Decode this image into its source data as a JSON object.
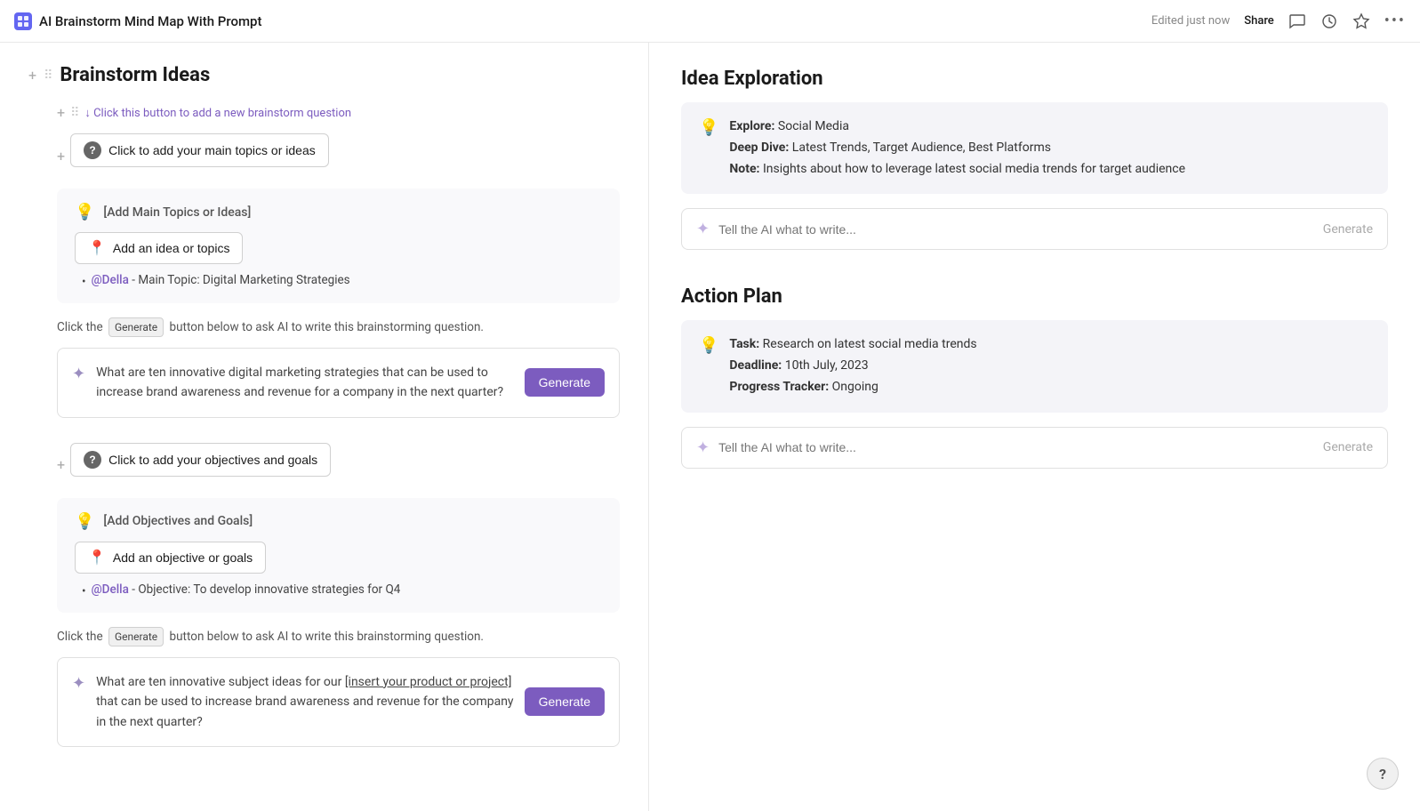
{
  "topbar": {
    "app_icon": "AI",
    "title": "AI Brainstorm Mind Map With Prompt",
    "edited_text": "Edited just now",
    "share_label": "Share",
    "more_icon": "•••"
  },
  "left": {
    "section_title": "Brainstorm Ideas",
    "sub_link_text": "↓ Click this button to add a new brainstorm question",
    "add_topic_btn_label": "Click to add your main topics or ideas",
    "ideas_card": {
      "title": "[Add Main Topics or Ideas]",
      "add_idea_label": "Add an idea or topics",
      "bullet": "@Della - Main Topic: Digital Marketing Strategies"
    },
    "generate_hint": "Click the Generate button below to ask AI to write this brainstorming question.",
    "generate_box": {
      "text": "What are ten innovative digital marketing strategies that can be used to increase brand awareness and revenue for a company in the next quarter?",
      "btn_label": "Generate"
    },
    "objectives_section": {
      "add_goals_btn_label": "Click to add your objectives and goals",
      "card_title": "[Add Objectives and Goals]",
      "add_goal_label": "Add an objective or goals",
      "bullet": "@Della - Objective: To develop innovative strategies for Q4"
    },
    "generate_hint2": "Click the Generate button below to ask AI to write this brainstorming question.",
    "generate_box2": {
      "text_prefix": "What are ten innovative subject ideas for our ",
      "text_link": "[insert your product or project]",
      "text_suffix": " that can be used to increase brand awareness and revenue for the company in the next quarter?",
      "btn_label": "Generate"
    }
  },
  "right": {
    "idea_exploration": {
      "title": "Idea Exploration",
      "card": {
        "explore_label": "Explore:",
        "explore_value": "Social Media",
        "deep_dive_label": "Deep Dive:",
        "deep_dive_value": "Latest Trends, Target Audience, Best Platforms",
        "note_label": "Note:",
        "note_value": "Insights about how to leverage latest social media trends for target audience"
      },
      "input_placeholder": "Tell the AI what to write...",
      "generate_label": "Generate"
    },
    "action_plan": {
      "title": "Action Plan",
      "card": {
        "task_label": "Task:",
        "task_value": "Research on latest social media trends",
        "deadline_label": "Deadline:",
        "deadline_value": "10th July, 2023",
        "progress_label": "Progress Tracker:",
        "progress_value": "Ongoing"
      },
      "input_placeholder": "Tell the AI what to write...",
      "generate_label": "Generate"
    }
  },
  "help_fab": "?"
}
